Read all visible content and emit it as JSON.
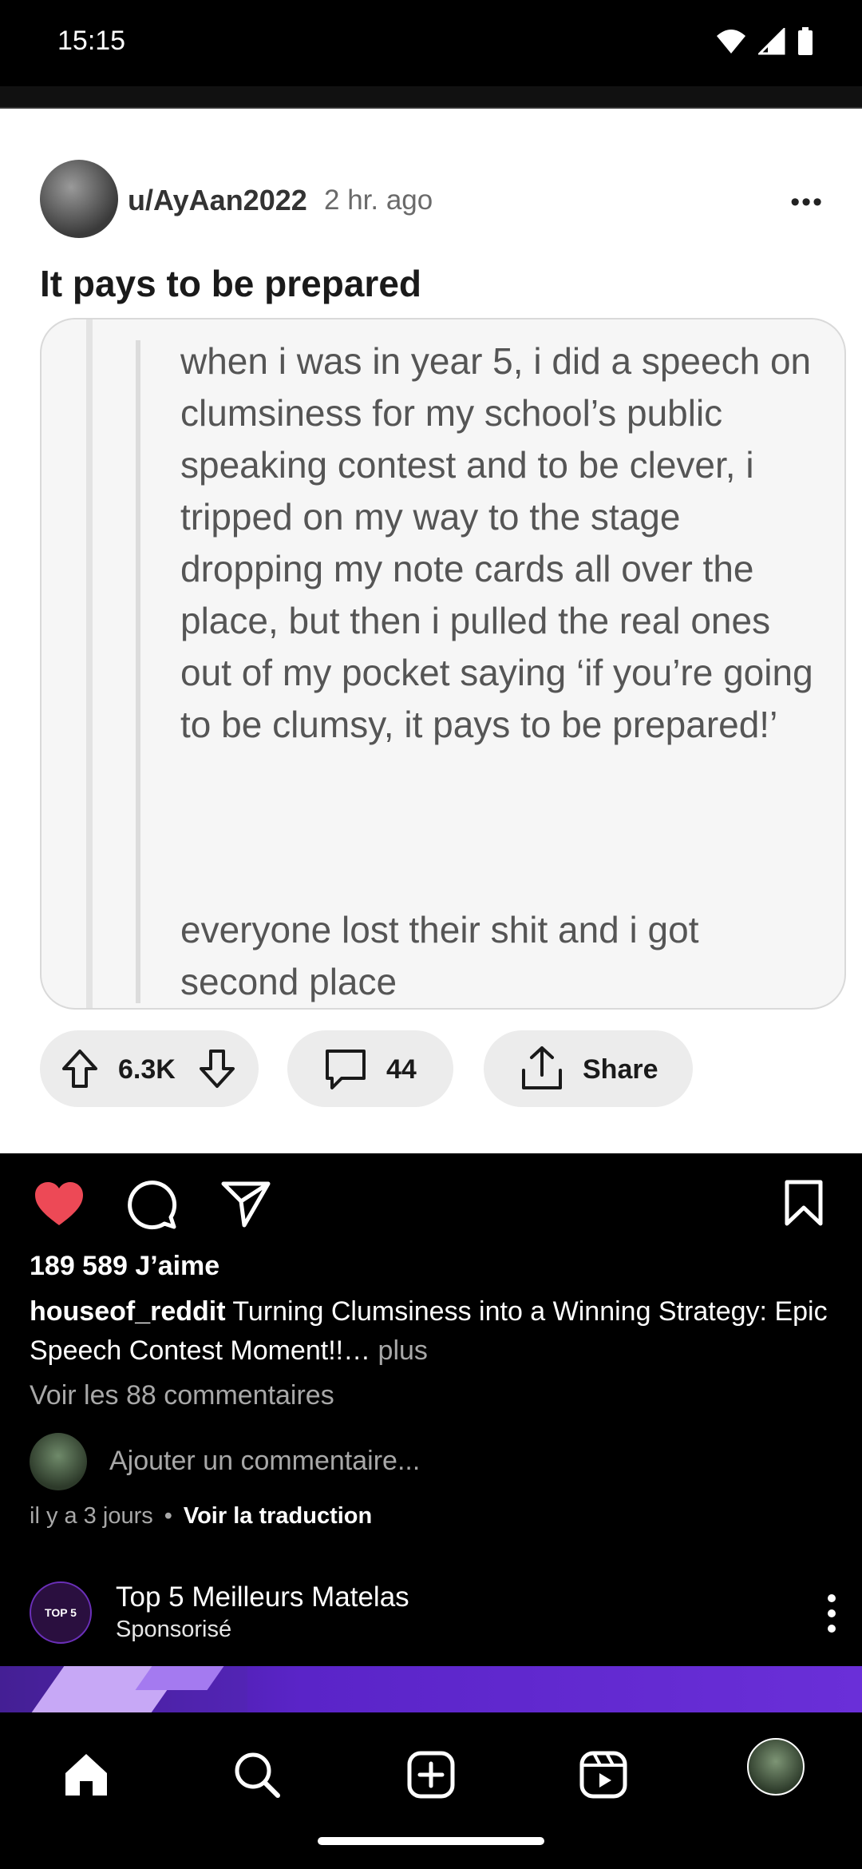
{
  "status_bar": {
    "time": "15:15"
  },
  "reddit_post": {
    "username": "u/AyAan2022",
    "time_ago": "2 hr. ago",
    "more": "•••",
    "title": "It pays to be prepared",
    "image_text_paragraph1": "when i was in year 5, i did a speech on clumsiness for my school’s public speaking contest and to be clever, i tripped on my way to the stage dropping my note cards all over the place, but then i pulled the real ones out of my pocket saying ‘if you’re going to be clumsy, it pays to be prepared!’",
    "image_text_paragraph2": "everyone lost their shit and i got second place",
    "votes": "6.3K",
    "comments": "44",
    "share_label": "Share"
  },
  "instagram_post": {
    "likes": "189 589 J’aime",
    "caption_user": "houseof_reddit",
    "caption_text": " Turning Clumsiness into a Winning Strategy: Epic Speech Contest Moment!!…",
    "caption_more": " plus",
    "view_comments": "Voir les 88 commentaires",
    "add_comment_placeholder": "Ajouter un commentaire...",
    "time_ago": "il y a 3 jours",
    "separator": "•",
    "translate": "Voir la traduction",
    "like_color": "#ed4956"
  },
  "sponsored": {
    "avatar_text": "TOP 5",
    "name": "Top 5 Meilleurs Matelas",
    "label": "Sponsorisé"
  },
  "bottom_nav": {
    "items": [
      "home-icon",
      "search-icon",
      "create-icon",
      "reels-icon",
      "profile-avatar"
    ]
  }
}
